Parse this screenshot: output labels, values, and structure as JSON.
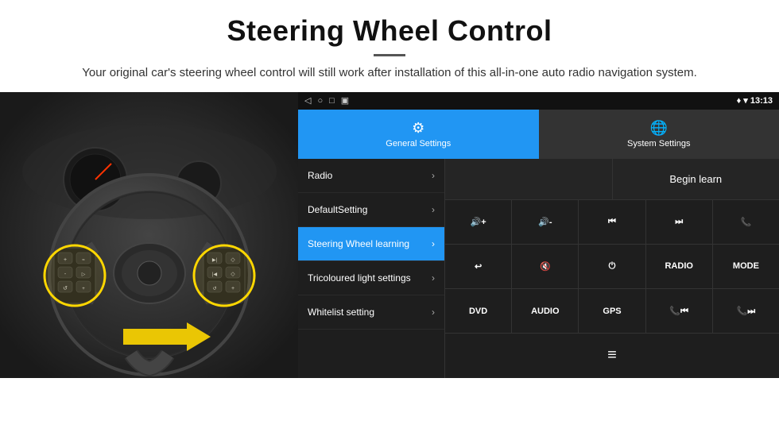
{
  "header": {
    "title": "Steering Wheel Control",
    "subtitle": "Your original car's steering wheel control will still work after installation of this all-in-one auto radio navigation system."
  },
  "status_bar": {
    "time": "13:13",
    "left_icons": [
      "◁",
      "○",
      "□",
      "▣"
    ]
  },
  "tabs": [
    {
      "id": "general",
      "label": "General Settings",
      "active": true,
      "icon": "⚙"
    },
    {
      "id": "system",
      "label": "System Settings",
      "active": false,
      "icon": "🌐"
    }
  ],
  "menu_items": [
    {
      "label": "Radio",
      "active": false
    },
    {
      "label": "DefaultSetting",
      "active": false
    },
    {
      "label": "Steering Wheel learning",
      "active": true
    },
    {
      "label": "Tricoloured light settings",
      "active": false
    },
    {
      "label": "Whitelist setting",
      "active": false
    }
  ],
  "begin_learn_button": "Begin learn",
  "control_buttons": {
    "row1": [
      {
        "label": "🔊+",
        "type": "icon"
      },
      {
        "label": "🔊-",
        "type": "icon"
      },
      {
        "label": "⏮",
        "type": "icon"
      },
      {
        "label": "⏭",
        "type": "icon"
      },
      {
        "label": "📞",
        "type": "icon"
      }
    ],
    "row2": [
      {
        "label": "↩",
        "type": "icon"
      },
      {
        "label": "🔇",
        "type": "icon"
      },
      {
        "label": "⏻",
        "type": "icon"
      },
      {
        "label": "RADIO",
        "type": "text"
      },
      {
        "label": "MODE",
        "type": "text"
      }
    ],
    "row3": [
      {
        "label": "DVD",
        "type": "text"
      },
      {
        "label": "AUDIO",
        "type": "text"
      },
      {
        "label": "GPS",
        "type": "text"
      },
      {
        "label": "📞⏮",
        "type": "icon"
      },
      {
        "label": "📞⏭",
        "type": "icon"
      }
    ],
    "row4": [
      {
        "label": "≡",
        "type": "icon"
      }
    ]
  }
}
